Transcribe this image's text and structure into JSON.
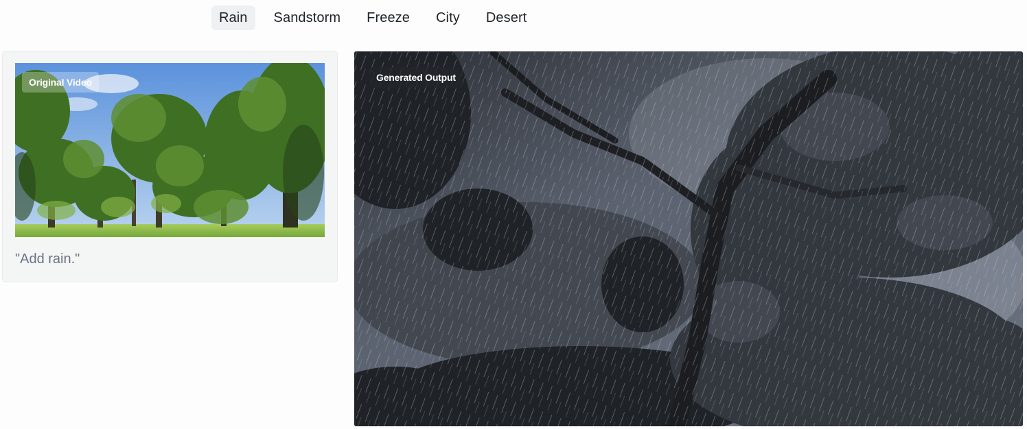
{
  "tabs": [
    {
      "label": "Rain",
      "active": true
    },
    {
      "label": "Sandstorm",
      "active": false
    },
    {
      "label": "Freeze",
      "active": false
    },
    {
      "label": "City",
      "active": false
    },
    {
      "label": "Desert",
      "active": false
    }
  ],
  "original": {
    "badge": "Original Video",
    "prompt": "\"Add rain.\""
  },
  "output": {
    "badge": "Generated Output"
  },
  "colors": {
    "sky": "#6fa3e3",
    "foliage": "#4a7a2c",
    "grass": "#8cbd4a",
    "storm_sky": "#5d6472",
    "storm_foliage": "#2b2e33"
  }
}
